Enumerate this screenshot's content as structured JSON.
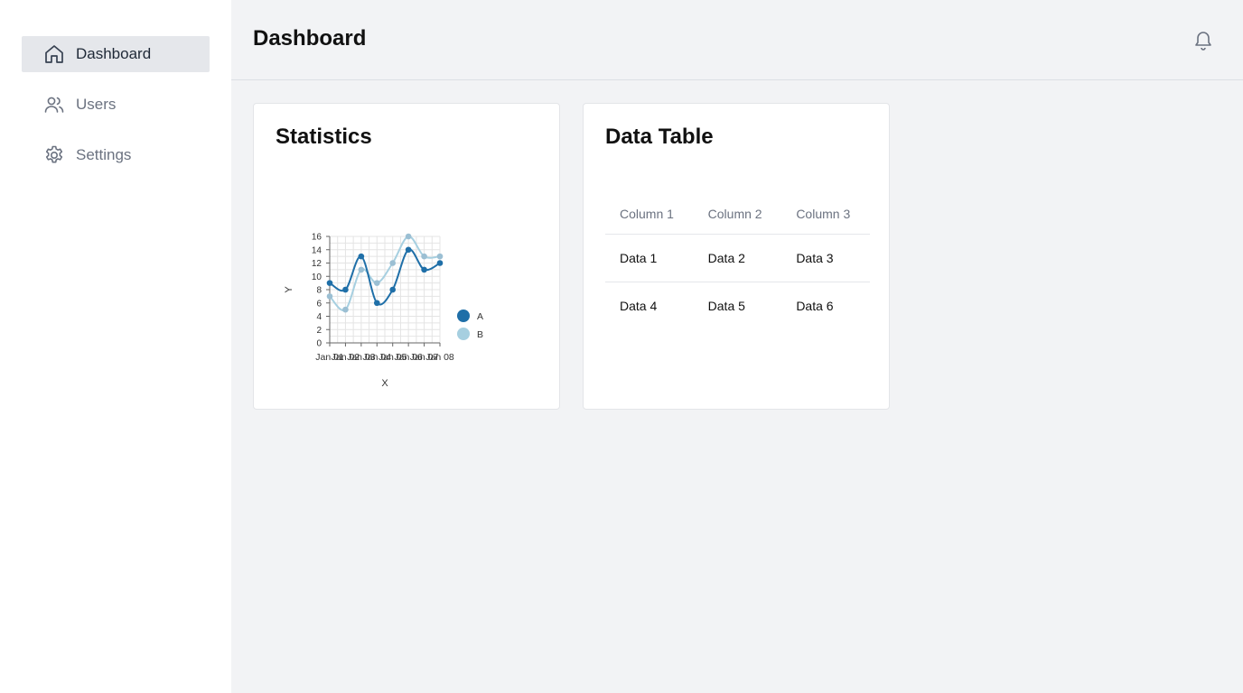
{
  "sidebar": {
    "items": [
      {
        "label": "Dashboard",
        "icon": "home-icon",
        "active": true
      },
      {
        "label": "Users",
        "icon": "users-icon",
        "active": false
      },
      {
        "label": "Settings",
        "icon": "gear-icon",
        "active": false
      }
    ]
  },
  "header": {
    "title": "Dashboard",
    "notification_icon": "bell-icon"
  },
  "cards": {
    "statistics": {
      "title": "Statistics"
    },
    "data_table": {
      "title": "Data Table",
      "columns": [
        "Column 1",
        "Column 2",
        "Column 3"
      ],
      "rows": [
        [
          "Data 1",
          "Data 2",
          "Data 3"
        ],
        [
          "Data 4",
          "Data 5",
          "Data 6"
        ]
      ]
    }
  },
  "colors": {
    "series_a": "#1f6fa8",
    "series_b": "#a6cfe0",
    "nav_active_bg": "#e5e7eb"
  },
  "chart_data": {
    "type": "line",
    "x": [
      "Jan 01",
      "Jan 02",
      "Jan 03",
      "Jan 04",
      "Jan 05",
      "Jan 06",
      "Jan 07",
      "Jan 08"
    ],
    "x_tick_labels": [
      "Jan 01",
      "Jan 02",
      "Jan 03",
      "Jan 04",
      "Jan 05",
      "Jan 06",
      "Jan 07",
      "Jan 08"
    ],
    "series": [
      {
        "name": "A",
        "values": [
          9,
          8,
          13,
          6,
          8,
          14,
          11,
          12
        ]
      },
      {
        "name": "B",
        "values": [
          7,
          5,
          11,
          9,
          12,
          16,
          13,
          13
        ]
      }
    ],
    "xlabel": "X",
    "ylabel": "Y",
    "ylim": [
      0,
      16
    ],
    "yticks": [
      0,
      2,
      4,
      6,
      8,
      10,
      12,
      14,
      16
    ],
    "grid": true,
    "legend": "right"
  }
}
